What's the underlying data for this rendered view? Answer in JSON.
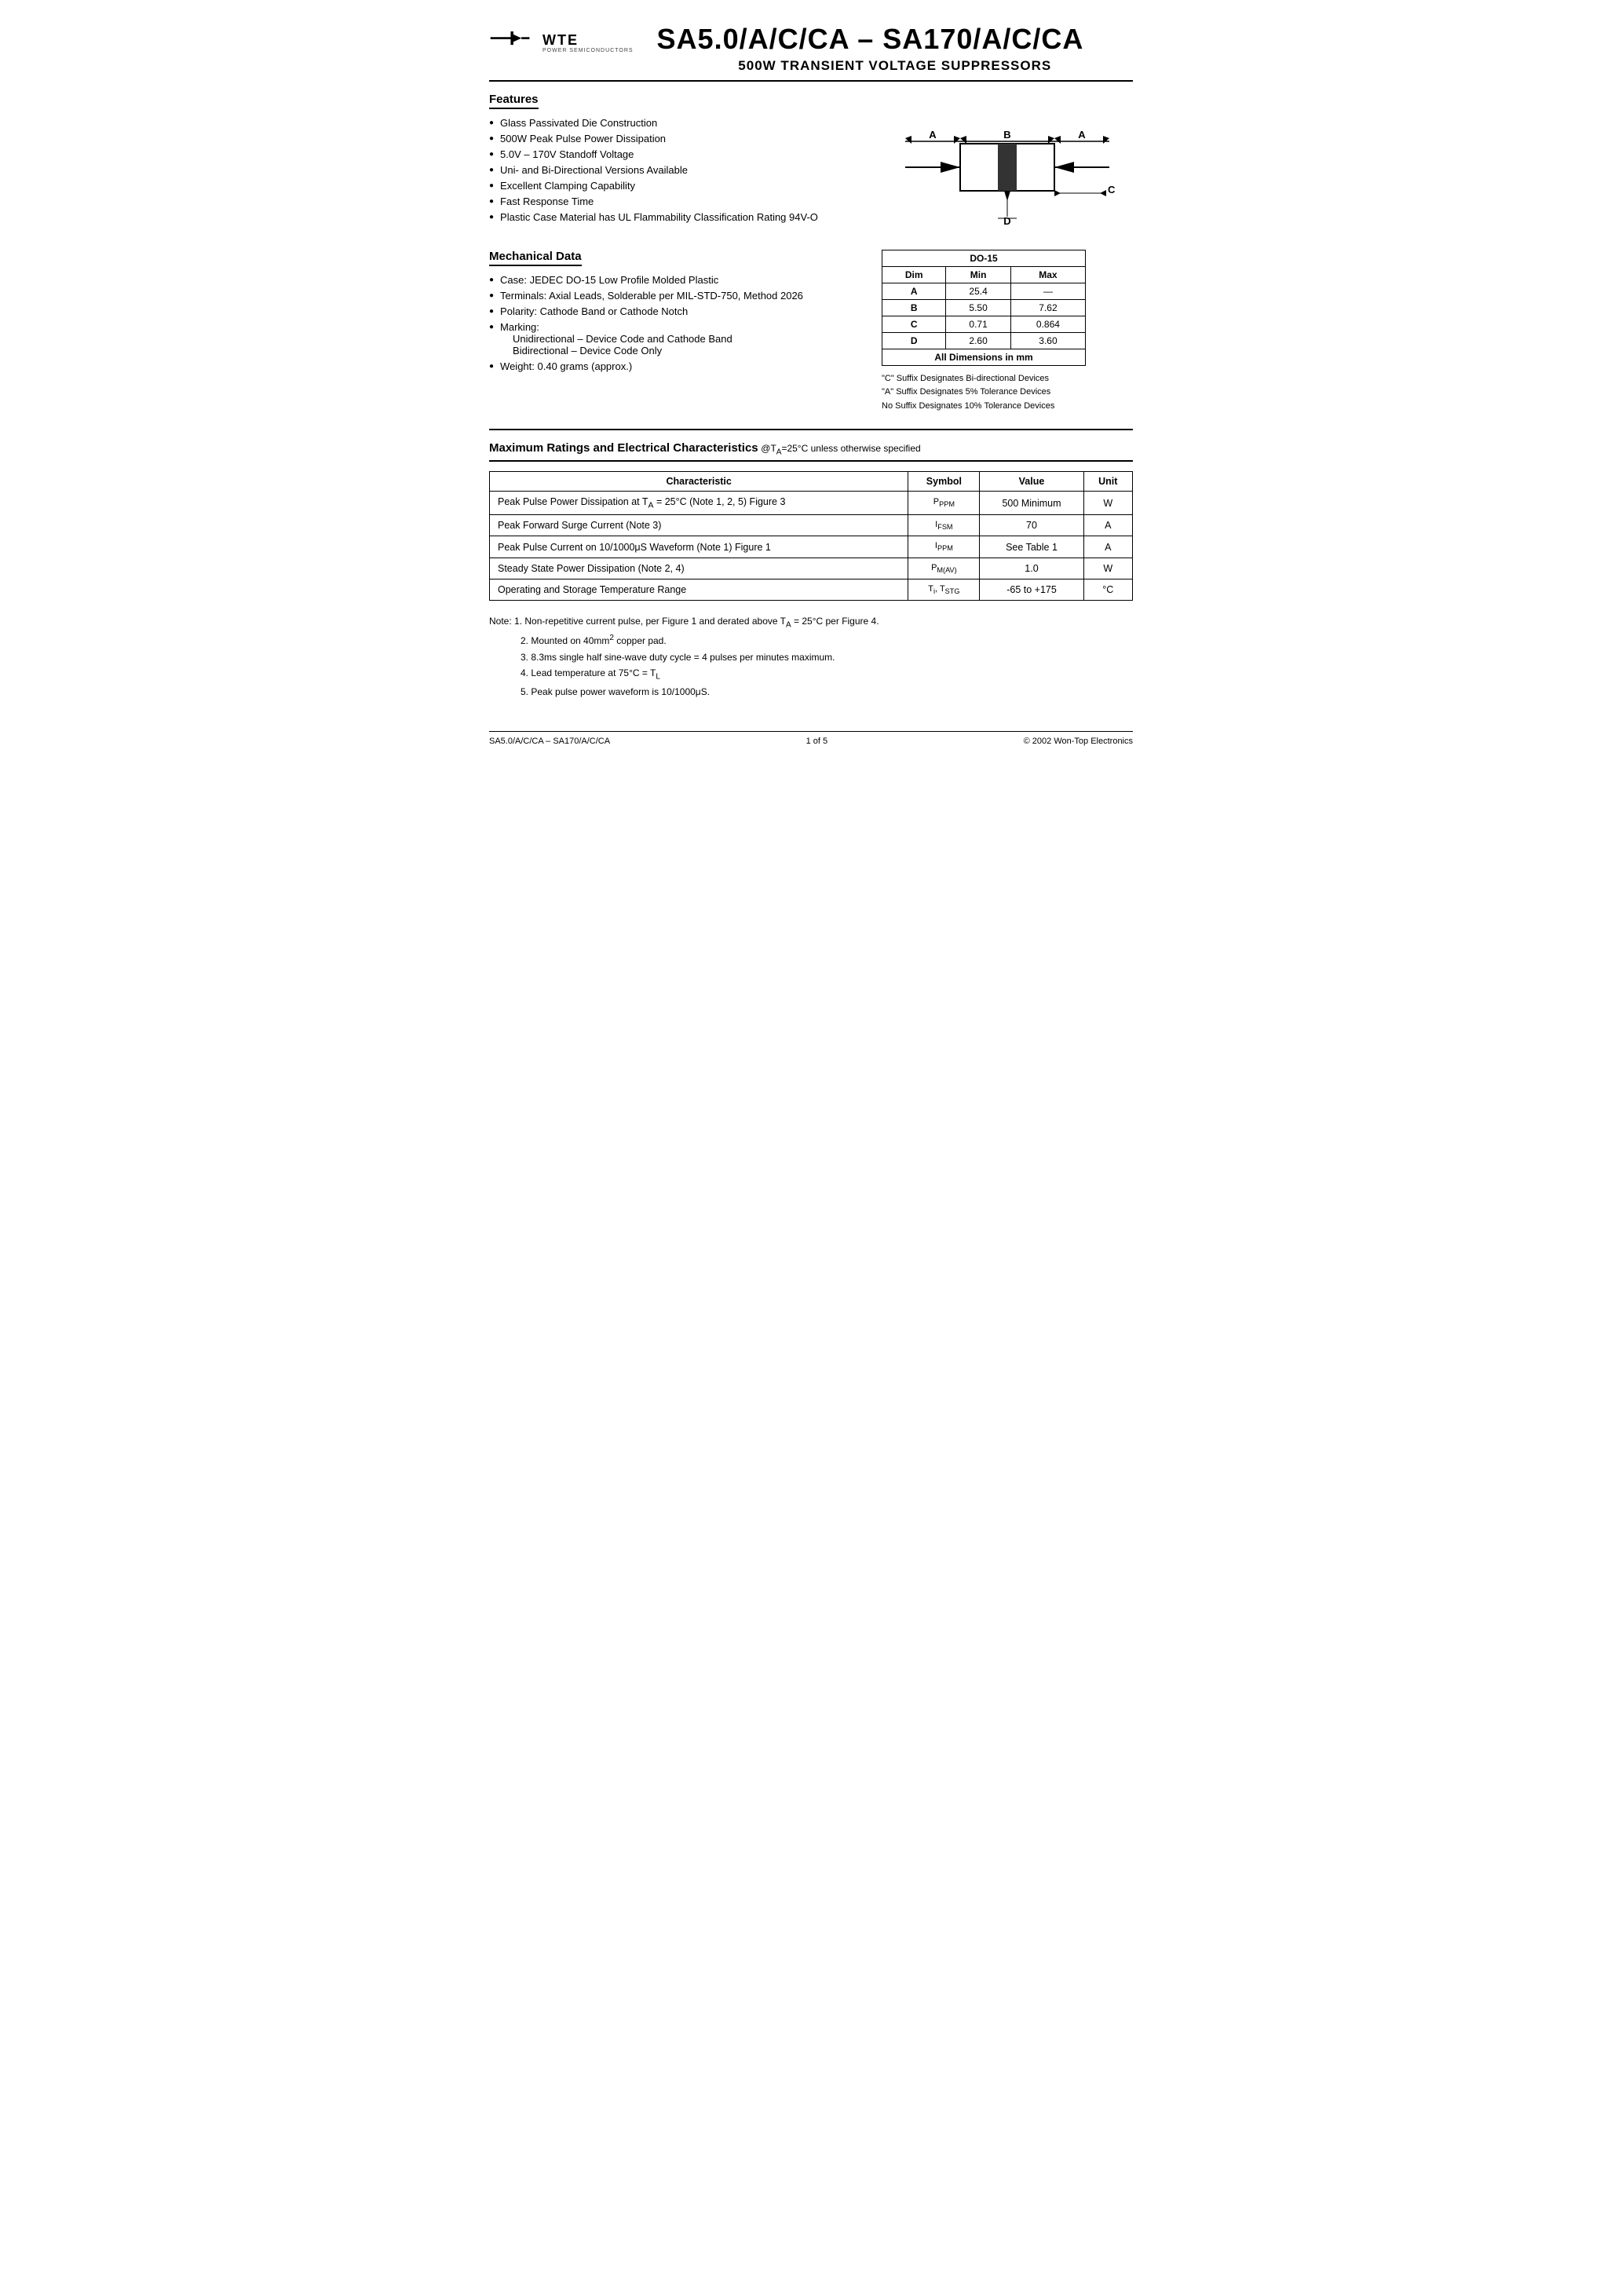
{
  "header": {
    "logo_text": "WTE",
    "logo_subtext": "POWER SEMICONDUCTORS",
    "main_title": "SA5.0/A/C/CA – SA170/A/C/CA",
    "sub_title": "500W TRANSIENT VOLTAGE SUPPRESSORS"
  },
  "features": {
    "section_title": "Features",
    "items": [
      "Glass Passivated Die Construction",
      "500W Peak Pulse Power Dissipation",
      "5.0V – 170V Standoff Voltage",
      "Uni- and Bi-Directional Versions Available",
      "Excellent Clamping Capability",
      "Fast Response Time",
      "Plastic Case Material has UL Flammability Classification Rating 94V-O"
    ]
  },
  "mechanical": {
    "section_title": "Mechanical Data",
    "items": [
      "Case: JEDEC DO-15 Low Profile Molded Plastic",
      "Terminals: Axial Leads, Solderable per MIL-STD-750, Method 2026",
      "Polarity: Cathode Band or Cathode Notch",
      "Marking:",
      "Unidirectional – Device Code and Cathode Band",
      "Bidirectional – Device Code Only",
      "Weight: 0.40 grams (approx.)"
    ]
  },
  "do15_table": {
    "title": "DO-15",
    "headers": [
      "Dim",
      "Min",
      "Max"
    ],
    "rows": [
      [
        "A",
        "25.4",
        "—"
      ],
      [
        "B",
        "5.50",
        "7.62"
      ],
      [
        "C",
        "0.71",
        "0.864"
      ],
      [
        "D",
        "2.60",
        "3.60"
      ]
    ],
    "footer": "All Dimensions in mm"
  },
  "suffix_notes": [
    "\"C\" Suffix Designates Bi-directional Devices",
    "\"A\" Suffix Designates 5% Tolerance Devices",
    "No Suffix Designates 10% Tolerance Devices"
  ],
  "max_ratings": {
    "section_title": "Maximum Ratings and Electrical Characteristics",
    "condition": "@Tₐ=25°C unless otherwise specified",
    "table_headers": [
      "Characteristic",
      "Symbol",
      "Value",
      "Unit"
    ],
    "rows": [
      {
        "characteristic": "Peak Pulse Power Dissipation at Tₐ = 25°C (Note 1, 2, 5) Figure 3",
        "symbol": "PPPM",
        "value": "500 Minimum",
        "unit": "W"
      },
      {
        "characteristic": "Peak Forward Surge Current (Note 3)",
        "symbol": "IFSM",
        "value": "70",
        "unit": "A"
      },
      {
        "characteristic": "Peak Pulse Current on 10/1000μS Waveform (Note 1) Figure 1",
        "symbol": "IPPM",
        "value": "See Table 1",
        "unit": "A"
      },
      {
        "characteristic": "Steady State Power Dissipation (Note 2, 4)",
        "symbol": "PM(AV)",
        "value": "1.0",
        "unit": "W"
      },
      {
        "characteristic": "Operating and Storage Temperature Range",
        "symbol": "Ti, TSTG",
        "value": "-65 to +175",
        "unit": "°C"
      }
    ]
  },
  "notes": {
    "label": "Note:",
    "items": [
      "1. Non-repetitive current pulse, per Figure 1 and derated above Tₐ = 25°C per Figure 4.",
      "2. Mounted on 40mm² copper pad.",
      "3. 8.3ms single half sine-wave duty cycle = 4 pulses per minutes maximum.",
      "4. Lead temperature at 75°C = T₁",
      "5. Peak pulse power waveform is 10/1000μS."
    ]
  },
  "footer": {
    "left": "SA5.0/A/C/CA – SA170/A/C/CA",
    "center": "1 of 5",
    "right": "© 2002 Won-Top Electronics"
  }
}
